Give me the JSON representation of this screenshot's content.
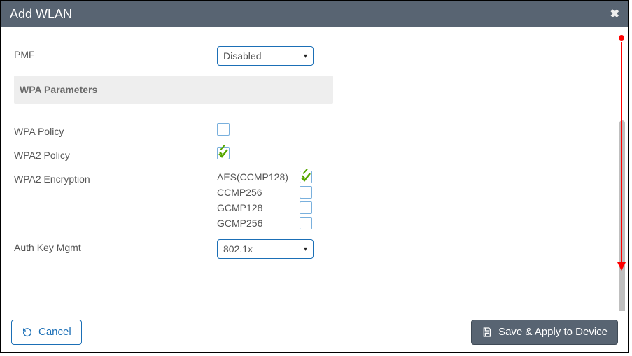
{
  "title": "Add WLAN",
  "fields": {
    "pmf_label": "PMF",
    "pmf_value": "Disabled",
    "wpa_section": "WPA Parameters",
    "wpa_policy_label": "WPA Policy",
    "wpa2_policy_label": "WPA2 Policy",
    "wpa2_enc_label": "WPA2 Encryption",
    "auth_key_label": "Auth Key Mgmt",
    "auth_key_value": "802.1x"
  },
  "encryption": [
    {
      "name": "AES(CCMP128)",
      "checked": true
    },
    {
      "name": "CCMP256",
      "checked": false
    },
    {
      "name": "GCMP128",
      "checked": false
    },
    {
      "name": "GCMP256",
      "checked": false
    }
  ],
  "checks": {
    "wpa_policy": false,
    "wpa2_policy": true
  },
  "footer": {
    "cancel": "Cancel",
    "save": "Save & Apply to Device"
  }
}
